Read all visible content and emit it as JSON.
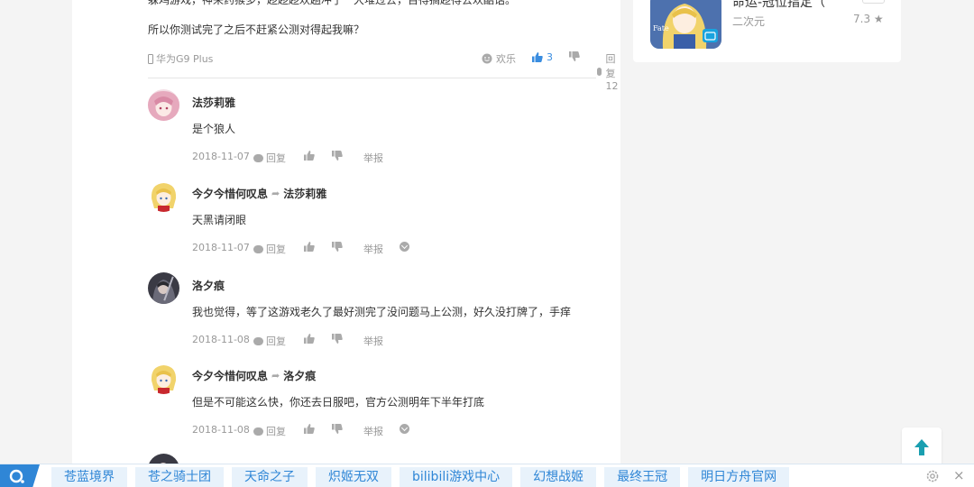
{
  "post": {
    "cut_line": "躲鸡游戏，神来药猴多，趁趁趁欢趟冲了一大堆过去，百得搞趁得去欢酷话。",
    "question": "所以你测试完了之后不赶紧公测对得起我嘛？",
    "device": "华为G9 Plus",
    "emotion_label": "欢乐",
    "like_count": "3",
    "reply_label": "回复 12"
  },
  "comments": [
    {
      "user": "法莎莉雅",
      "reply_to": "",
      "text": "是个狼人",
      "date": "2018-11-07",
      "reply": "回复",
      "report": "举报",
      "has_check": false
    },
    {
      "user": "今夕今惜何叹息",
      "reply_to": "法莎莉雅",
      "text": "天黑请闭眼",
      "date": "2018-11-07",
      "reply": "回复",
      "report": "举报",
      "has_check": true
    },
    {
      "user": "洛夕痕",
      "reply_to": "",
      "text": "我也觉得，等了这游戏老久了最好测完了没问题马上公测，好久没打牌了，手痒",
      "date": "2018-11-08",
      "reply": "回复",
      "report": "举报",
      "has_check": false
    },
    {
      "user": "今夕今惜何叹息",
      "reply_to": "洛夕痕",
      "text": "但是不可能这么快，你还去日服吧，官方公测明年下半年打底",
      "date": "2018-11-08",
      "reply": "回复",
      "report": "举报",
      "has_check": true
    }
  ],
  "side": {
    "game_title": "命运-冠位指定（",
    "tag": "二次元",
    "score": "7.3 ★",
    "icon_text": "Fate/Grand Order"
  },
  "bottom_bar": {
    "links": [
      "苍蓝境界",
      "苍之骑士团",
      "天命之子",
      "炽姬无双",
      "bilibili游戏中心",
      "幻想战姬",
      "最终王冠",
      "明日方舟官网"
    ],
    "close": "×"
  },
  "colors": {
    "accent": "#2f86d6",
    "like": "#3a8de0",
    "top_button_arrow": "#1a9fb0"
  }
}
